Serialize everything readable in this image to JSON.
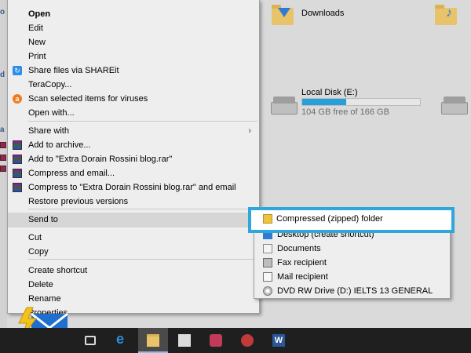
{
  "explorer": {
    "folders": [
      {
        "name": "downloads",
        "label": "Downloads"
      }
    ],
    "drive": {
      "label": "Local Disk (E:)",
      "free_text": "104 GB free of 166 GB",
      "used_fraction": 0.37
    },
    "strip_text": [
      "o",
      "d",
      "a"
    ]
  },
  "context_menu": {
    "items": [
      {
        "label": "Open",
        "bold": true
      },
      {
        "label": "Edit"
      },
      {
        "label": "New"
      },
      {
        "label": "Print"
      },
      {
        "label": "Share files via SHAREit",
        "icon": "shareit-icon"
      },
      {
        "label": "TeraCopy..."
      },
      {
        "label": "Scan selected items for viruses",
        "icon": "avast-icon"
      },
      {
        "label": "Open with..."
      },
      {
        "label": "Share with",
        "submenu": true
      },
      {
        "label": "Add to archive...",
        "icon": "winrar-icon"
      },
      {
        "label": "Add to \"Extra Dorain Rossini blog.rar\"",
        "icon": "winrar-icon"
      },
      {
        "label": "Compress and email...",
        "icon": "winrar-icon"
      },
      {
        "label": "Compress to \"Extra Dorain Rossini blog.rar\" and email",
        "icon": "winrar-icon"
      },
      {
        "label": "Restore previous versions"
      },
      {
        "label": "Send to",
        "submenu": true,
        "hover": true
      },
      {
        "label": "Cut"
      },
      {
        "label": "Copy"
      },
      {
        "label": "Create shortcut"
      },
      {
        "label": "Delete"
      },
      {
        "label": "Rename"
      },
      {
        "label": "Properties"
      }
    ]
  },
  "send_to_menu": {
    "items": [
      {
        "label": "Compressed (zipped) folder",
        "icon": "zip-folder-icon",
        "highlighted": true
      },
      {
        "label": "Desktop (create shortcut)",
        "icon": "desktop-icon"
      },
      {
        "label": "Documents",
        "icon": "documents-icon"
      },
      {
        "label": "Fax recipient",
        "icon": "fax-icon"
      },
      {
        "label": "Mail recipient",
        "icon": "mail-icon"
      },
      {
        "label": "DVD RW Drive (D:) IELTS 13 GENERAL",
        "icon": "dvd-icon"
      }
    ]
  },
  "taskbar": {
    "apps": [
      "task-view-icon",
      "edge-icon",
      "file-explorer-icon",
      "store-icon",
      "app-icon",
      "app-circle-icon",
      "word-icon"
    ],
    "word_letter": "W"
  },
  "colors": {
    "highlight_border": "#2fa6dc",
    "drive_fill": "#26a0da",
    "taskbar": "#1f1f1f"
  }
}
